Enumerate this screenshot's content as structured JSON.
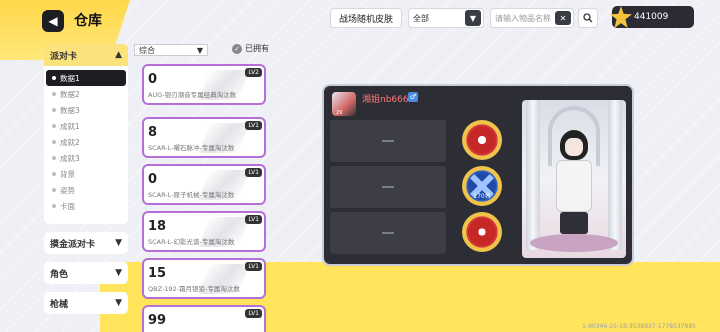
{
  "header": {
    "back_icon": "back-arrow-icon",
    "title": "仓库",
    "tab_label": "战场随机皮肤",
    "filter_value": "全部",
    "search_placeholder": "请输入物品名称",
    "currency_value": "441009"
  },
  "sidebar": {
    "category_open": "派对卡",
    "items": [
      {
        "label": "数据1",
        "active": true
      },
      {
        "label": "数据2",
        "active": false
      },
      {
        "label": "数据3",
        "active": false
      },
      {
        "label": "成就1",
        "active": false
      },
      {
        "label": "成就2",
        "active": false
      },
      {
        "label": "成就3",
        "active": false
      },
      {
        "label": "背景",
        "active": false
      },
      {
        "label": "姿势",
        "active": false
      },
      {
        "label": "卡面",
        "active": false
      }
    ],
    "collapsed": [
      "摸金派对卡",
      "角色",
      "枪械"
    ]
  },
  "list_controls": {
    "sort_value": "综合",
    "owned_label": "已拥有"
  },
  "cards": [
    {
      "count": "0",
      "name": "AUG-银刃潮音专属经典淘汰数",
      "level": "LV2"
    },
    {
      "count": "8",
      "name": "SCAR-L-曜石脉冲-专属淘汰数",
      "level": "LV1"
    },
    {
      "count": "0",
      "name": "SCAR-L-原子机械-专属淘汰数",
      "level": "LV1"
    },
    {
      "count": "18",
      "name": "SCAR-L-幻影光谱-专属淘汰数",
      "level": "LV1"
    },
    {
      "count": "15",
      "name": "QBZ-192-霜月银狼-专属淘汰数",
      "level": "LV1"
    },
    {
      "count": "99",
      "name": "",
      "level": "LV1"
    }
  ],
  "detail": {
    "user_name": "湘姐nb666",
    "avatar_rank": "29",
    "badges": [
      {
        "icon": "red-emblem-icon",
        "label": ""
      },
      {
        "icon": "blue-x-emblem-icon",
        "label": "170名"
      },
      {
        "icon": "red-crown-emblem-icon",
        "label": ""
      }
    ]
  },
  "footer_id": "1-90346-25-18-3538937-1778537985"
}
